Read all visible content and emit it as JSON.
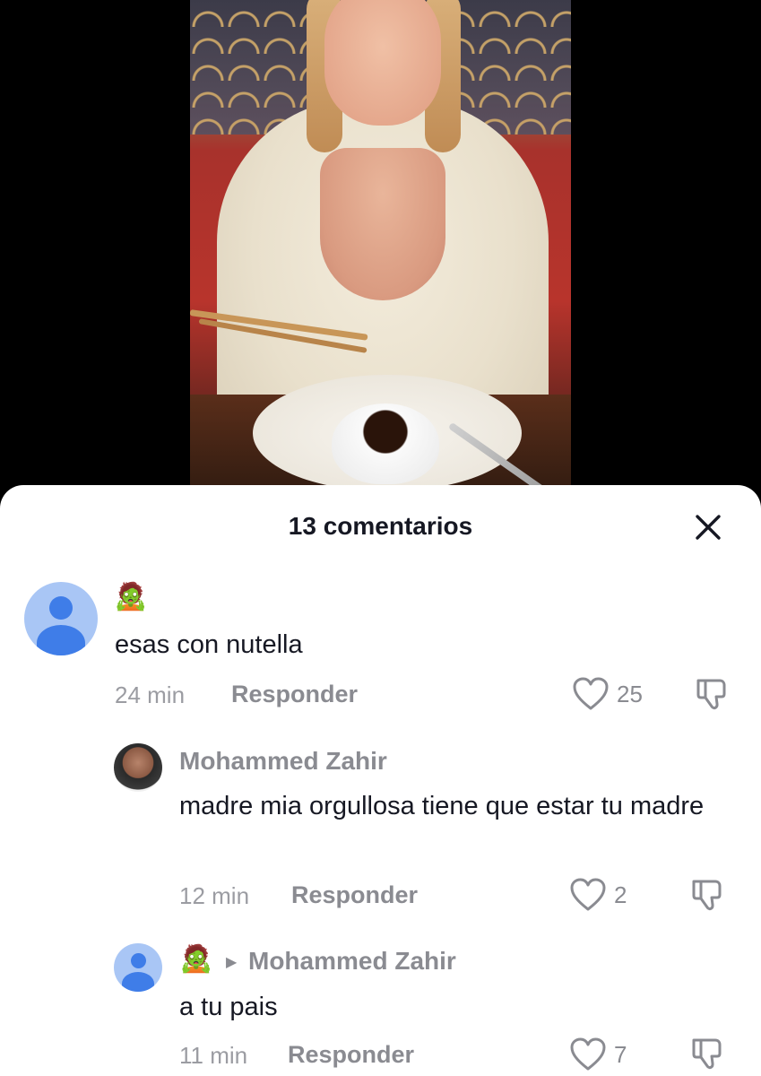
{
  "header": {
    "title": "13 comentarios"
  },
  "comments": [
    {
      "username_emoji": "🧟",
      "text": "esas con nutella",
      "time": "24 min",
      "reply_label": "Responder",
      "likes": "25"
    },
    {
      "username": "Mohammed Zahir",
      "text": "madre mia orgullosa tiene que estar tu madre",
      "time": "12 min",
      "reply_label": "Responder",
      "likes": "2"
    },
    {
      "username_emoji": "🧟",
      "reply_to": "Mohammed Zahir",
      "text": "a tu pais",
      "time": "11 min",
      "reply_label": "Responder",
      "likes": "7"
    }
  ],
  "icons": {
    "close": "close-icon",
    "like": "heart-icon",
    "dislike": "thumbs-down-icon",
    "default_avatar": "user-avatar-icon"
  },
  "colors": {
    "sheet_bg": "#ffffff",
    "text_primary": "#161823",
    "text_secondary": "#8a8b91",
    "avatar_blue": "#3f7de8",
    "avatar_bg": "#a9c6f5"
  }
}
